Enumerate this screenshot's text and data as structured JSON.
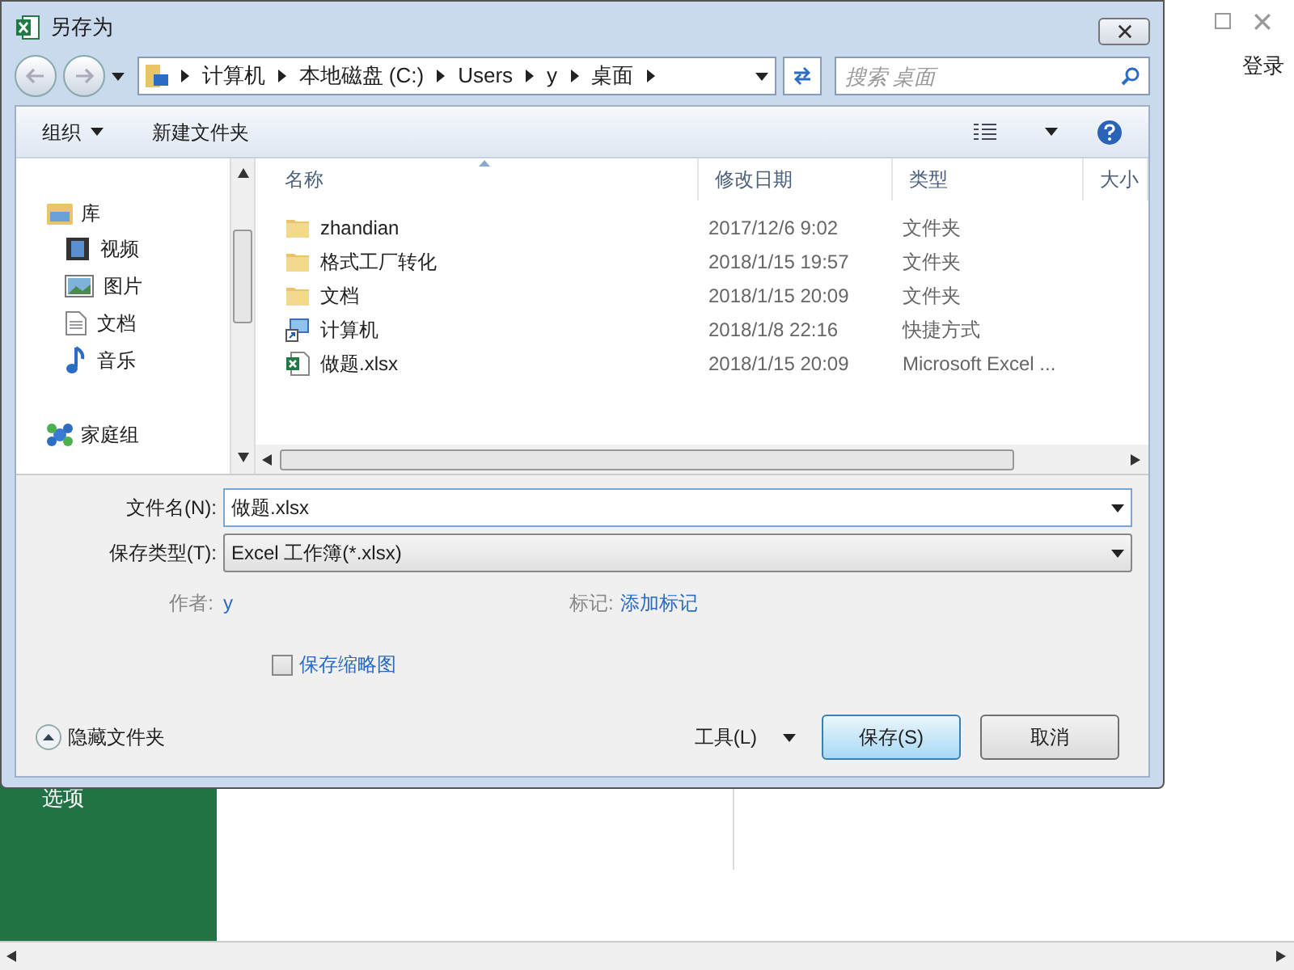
{
  "window": {
    "title": "另存为"
  },
  "address": {
    "crumbs": [
      "计算机",
      "本地磁盘 (C:)",
      "Users",
      "y",
      "桌面"
    ]
  },
  "search": {
    "placeholder": "搜索 桌面"
  },
  "toolbar": {
    "organize": "组织",
    "new_folder": "新建文件夹"
  },
  "nav_tree": [
    {
      "label": "库",
      "kind": "library",
      "children": [
        {
          "label": "视频",
          "kind": "video"
        },
        {
          "label": "图片",
          "kind": "picture"
        },
        {
          "label": "文档",
          "kind": "document"
        },
        {
          "label": "音乐",
          "kind": "music"
        }
      ]
    },
    {
      "label": "家庭组",
      "kind": "homegroup"
    }
  ],
  "table": {
    "columns": [
      "名称",
      "修改日期",
      "类型",
      "大小"
    ],
    "rows": [
      {
        "kind": "folder",
        "name": "zhandian",
        "date": "2017/12/6 9:02",
        "type": "文件夹"
      },
      {
        "kind": "folder",
        "name": "格式工厂转化",
        "date": "2018/1/15 19:57",
        "type": "文件夹"
      },
      {
        "kind": "folder",
        "name": "文档",
        "date": "2018/1/15 20:09",
        "type": "文件夹"
      },
      {
        "kind": "shortcut",
        "name": "计算机",
        "date": "2018/1/8 22:16",
        "type": "快捷方式"
      },
      {
        "kind": "excel",
        "name": "做题.xlsx",
        "date": "2018/1/15 20:09",
        "type": "Microsoft Excel ..."
      }
    ]
  },
  "form": {
    "filename": {
      "label": "文件名(N):",
      "value": "做题.xlsx"
    },
    "filetype": {
      "label": "保存类型(T):",
      "value": "Excel 工作簿(*.xlsx)"
    },
    "author": {
      "label": "作者:",
      "value": "y"
    },
    "tags": {
      "label": "标记:",
      "value": "添加标记"
    },
    "thumbnail": {
      "label": "保存缩略图",
      "checked": false
    }
  },
  "footer": {
    "hide_folders": "隐藏文件夹",
    "tools": "工具(L)",
    "save": "保存(S)",
    "cancel": "取消"
  },
  "background": {
    "login": "登录",
    "sidebar_item": "选项"
  }
}
